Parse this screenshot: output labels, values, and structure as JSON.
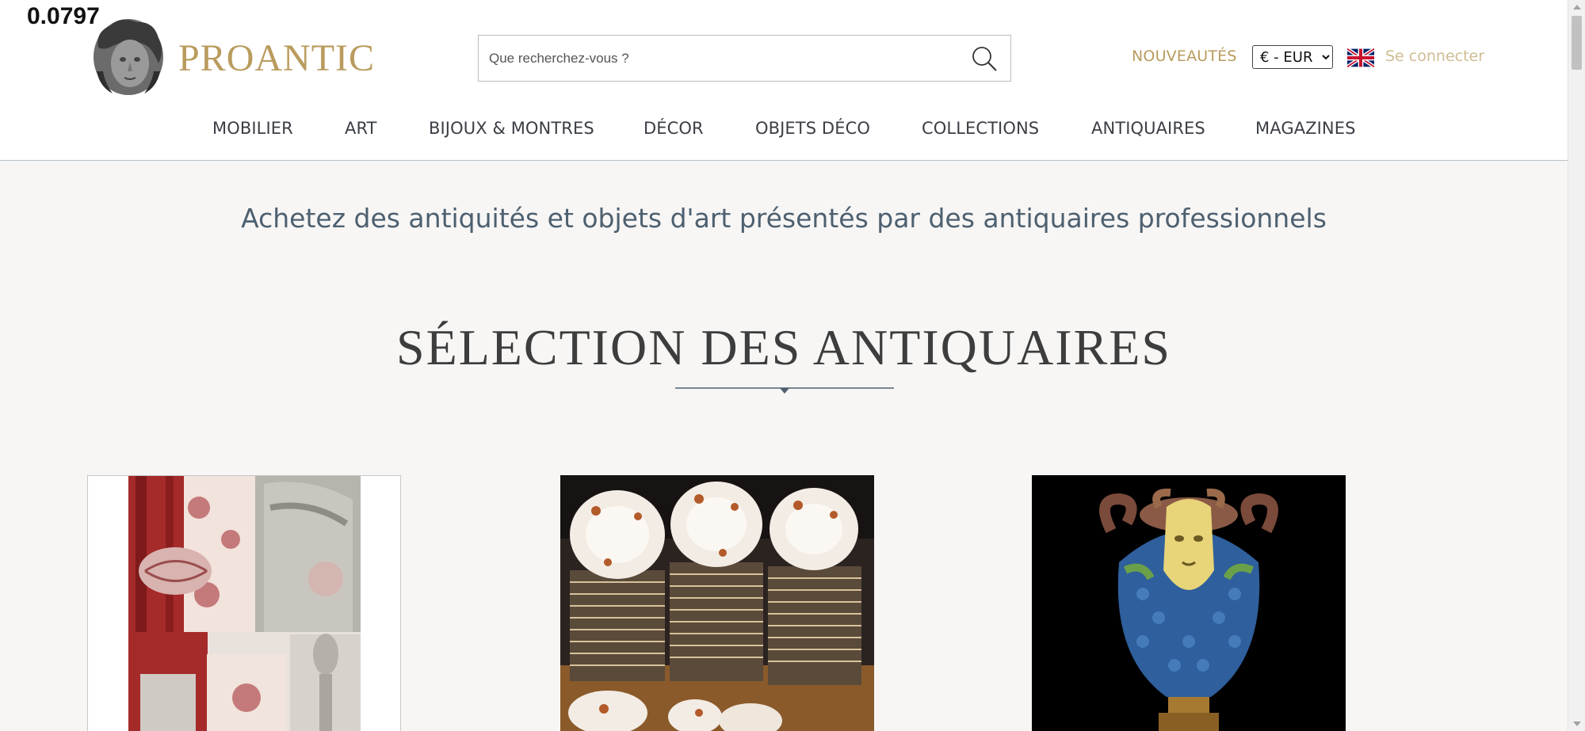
{
  "overlay": {
    "value": "0.0797"
  },
  "header": {
    "logo_text": "PROANTIC",
    "search_placeholder": "Que recherchez-vous ?",
    "nouveautes": "NOUVEAUTÉS",
    "currency": "€ - EUR",
    "language_flag": "uk-flag-icon",
    "login": "Se connecter"
  },
  "nav": {
    "items": [
      "MOBILIER",
      "ART",
      "BIJOUX & MONTRES",
      "DÉCOR",
      "OBJETS DÉCO",
      "COLLECTIONS",
      "ANTIQUAIRES",
      "MAGAZINES"
    ]
  },
  "hero": {
    "tagline": "Achetez des antiquités et objets d'art présentés par des antiquaires professionnels",
    "section_title": "SÉLECTION DES ANTIQUAIRES"
  },
  "colors": {
    "gold": "#b99b5d",
    "slate": "#4d6070",
    "background": "#f7f6f5"
  }
}
